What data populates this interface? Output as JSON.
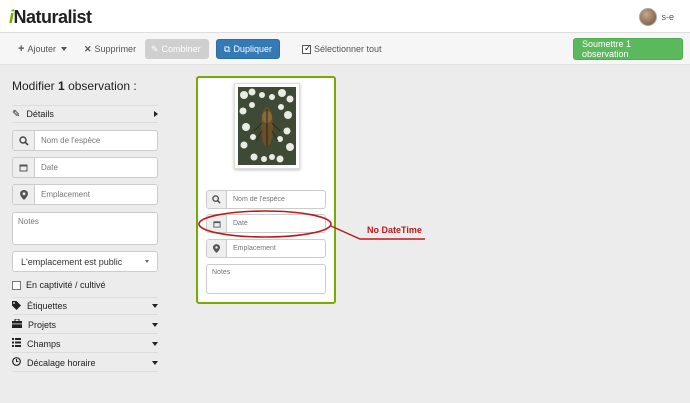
{
  "app": {
    "logo_prefix": "i",
    "logo_rest": "Naturalist",
    "username": "s-e"
  },
  "toolbar": {
    "add_label": "Ajouter",
    "delete_label": "Supprimer",
    "combine_label": "Combiner",
    "duplicate_label": "Dupliquer",
    "select_all_label": "Sélectionner tout",
    "submit_label": "Soumettre 1 observation"
  },
  "sidebar": {
    "title_prefix": "Modifier",
    "title_count": "1",
    "title_suffix": "observation :",
    "details_label": "Détails",
    "species_placeholder": "Nom de l'espèce",
    "date_placeholder": "Date",
    "location_placeholder": "Emplacement",
    "notes_placeholder": "Notes",
    "geoprivacy_value": "L'emplacement est public",
    "captive_label": "En captivité / cultivé",
    "sections": [
      {
        "label": "Étiquettes",
        "icon": "tag-icon"
      },
      {
        "label": "Projets",
        "icon": "briefcase-icon"
      },
      {
        "label": "Champs",
        "icon": "list-icon"
      },
      {
        "label": "Décalage horaire",
        "icon": "clock-icon"
      }
    ]
  },
  "card": {
    "species_placeholder": "Nom de l'espèce",
    "date_placeholder": "Date",
    "location_placeholder": "Emplacement",
    "notes_placeholder": "Notes"
  },
  "annotation": {
    "text": "No DateTime",
    "color": "#c0181b"
  },
  "colors": {
    "accent_green": "#74ac00",
    "primary_blue": "#337ab7",
    "success_green": "#5cb85c"
  }
}
